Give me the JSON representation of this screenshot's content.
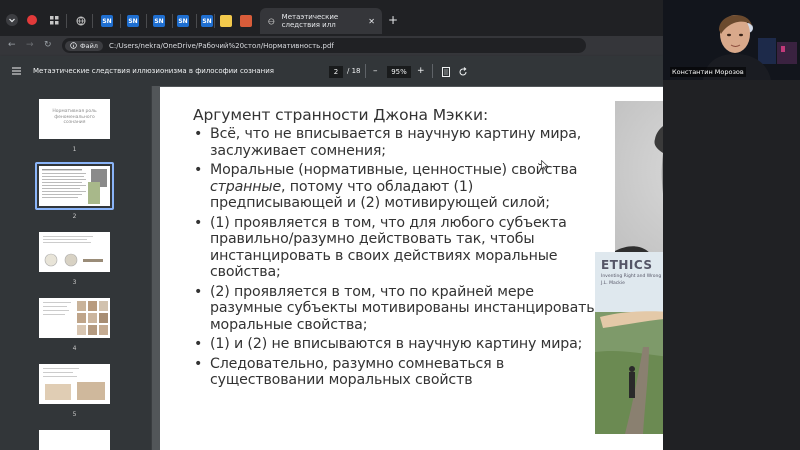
{
  "browser": {
    "tabs": [
      {
        "label": "SN",
        "icon": "sn-icon"
      },
      {
        "label": "SN",
        "icon": "sn-icon"
      },
      {
        "label": "SN",
        "icon": "sn-icon"
      },
      {
        "label": "SN",
        "icon": "sn-icon"
      },
      {
        "label": "SN",
        "icon": "sn-icon"
      }
    ],
    "active_tab": {
      "label": "Метаэтические следствия илл"
    },
    "new_tab": "+",
    "address": {
      "chip": "Файл",
      "url": "C:/Users/nekra/OneDrive/Рабочий%20стол/Нормативность.pdf"
    }
  },
  "pdf": {
    "title": "Метаэтические следствия иллюзионизма в философии сознания",
    "current_page": "2",
    "total_pages": "/ 18",
    "zoom": "95%",
    "minus": "–",
    "plus": "+",
    "thumbnails": [
      {
        "num": "1",
        "title": "Нормативная роль феноменального сознания"
      },
      {
        "num": "2"
      },
      {
        "num": "3"
      },
      {
        "num": "4"
      },
      {
        "num": "5"
      }
    ]
  },
  "slide": {
    "heading": "Аргумент странности Джона Мэкки:",
    "b1": "Всё, что не вписывается в научную картину мира, заслуживает сомнения;",
    "b2_pre": "Моральные (нормативные, ценностные) свойства ",
    "b2_em": "странные",
    "b2_post": ", потому что обладают (1) предписывающей и (2) мотивирующей силой;",
    "b3": "(1) проявляется в том, что для любого субъекта правильно/разумно действовать так, чтобы инстанцировать в своих действиях моральные свойства;",
    "b4": "(2) проявляется в том, что по крайней мере разумные субъекты мотивированы инстанцировать моральные свойства;",
    "b5": "(1) и (2) не вписываются в научную картину мира;",
    "b6": "Следовательно, разумно сомневаться в существовании моральных свойств",
    "book": {
      "title": "ETHICS",
      "subtitle": "Inventing Right and Wrong",
      "author": "J.L. Mackie"
    }
  },
  "video": {
    "participant_name": "Константин Морозов"
  },
  "watermark": "ZO",
  "colors": {
    "selection": "#8ab4f8",
    "sn_brand": "#1f6fd1"
  }
}
